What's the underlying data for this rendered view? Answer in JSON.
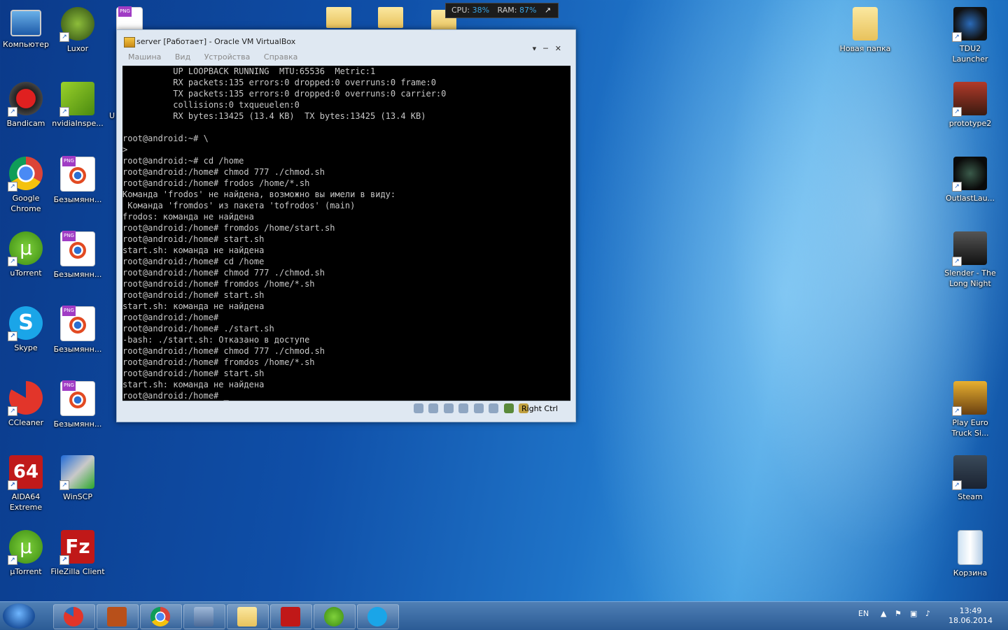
{
  "desktop": {
    "icons_left": [
      {
        "label": "Компьютер",
        "icon": "computer-icon"
      },
      {
        "label": "Luxor",
        "icon": "luxor-icon"
      },
      {
        "label": "Bandicam",
        "icon": "bandicam-icon"
      },
      {
        "label": "nvidiaInspe...",
        "icon": "nvidia-icon"
      },
      {
        "label": "Google Chrome",
        "icon": "chrome-icon"
      },
      {
        "label": "Безымянн...",
        "icon": "png-file-icon"
      },
      {
        "label": "uTorrent",
        "icon": "utorrent-icon"
      },
      {
        "label": "Безымянн...",
        "icon": "png-file-icon"
      },
      {
        "label": "Skype",
        "icon": "skype-icon"
      },
      {
        "label": "Безымянн...",
        "icon": "png-file-icon"
      },
      {
        "label": "CCleaner",
        "icon": "ccleaner-icon"
      },
      {
        "label": "Безымянн...",
        "icon": "png-file-icon"
      },
      {
        "label": "AIDA64 Extreme",
        "icon": "aida64-icon"
      },
      {
        "label": "WinSCP",
        "icon": "winscp-icon"
      },
      {
        "label": "µTorrent",
        "icon": "utorrent-icon"
      },
      {
        "label": "FileZilla Client",
        "icon": "filezilla-icon"
      }
    ],
    "partial_label": "U",
    "icons_right": [
      {
        "label": "Новая папка",
        "icon": "folder-icon"
      },
      {
        "label": "TDU2 Launcher",
        "icon": "tdu2-icon"
      },
      {
        "label": "prototype2",
        "icon": "prototype2-icon"
      },
      {
        "label": "OutlastLau...",
        "icon": "outlast-icon"
      },
      {
        "label": "Slender - The Long Night",
        "icon": "slender-icon"
      },
      {
        "label": "Play Euro Truck Si...",
        "icon": "eurotruck-icon"
      },
      {
        "label": "Steam",
        "icon": "steam-icon"
      },
      {
        "label": "Корзина",
        "icon": "recycle-bin-icon"
      }
    ]
  },
  "perf": {
    "cpu_label": "CPU:",
    "cpu": "38%",
    "ram_label": "RAM:",
    "ram": "87%",
    "arrow": "↗"
  },
  "vbox": {
    "title": "server [Работает] - Oracle VM VirtualBox",
    "buttons": [
      "▾",
      "─",
      "✕"
    ],
    "menu": [
      "Машина",
      "Вид",
      "Устройства",
      "Справка"
    ],
    "host_key": "Right Ctrl",
    "terminal_lines": [
      "          UP LOOPBACK RUNNING  MTU:65536  Metric:1",
      "          RX packets:135 errors:0 dropped:0 overruns:0 frame:0",
      "          TX packets:135 errors:0 dropped:0 overruns:0 carrier:0",
      "          collisions:0 txqueuelen:0",
      "          RX bytes:13425 (13.4 KB)  TX bytes:13425 (13.4 KB)",
      "",
      "root@android:~# \\",
      ">",
      "root@android:~# cd /home",
      "root@android:/home# chmod 777 ./chmod.sh",
      "root@android:/home# frodos /home/*.sh",
      "Команда 'frodos' не найдена, возможно вы имели в виду:",
      " Команда 'fromdos' из пакета 'tofrodos' (main)",
      "frodos: команда не найдена",
      "root@android:/home# fromdos /home/start.sh",
      "root@android:/home# start.sh",
      "start.sh: команда не найдена",
      "root@android:/home# cd /home",
      "root@android:/home# chmod 777 ./chmod.sh",
      "root@android:/home# fromdos /home/*.sh",
      "root@android:/home# start.sh",
      "start.sh: команда не найдена",
      "root@android:/home#",
      "root@android:/home# ./start.sh",
      "-bash: ./start.sh: Отказано в доступе",
      "root@android:/home# chmod 777 ./chmod.sh",
      "root@android:/home# fromdos /home/*.sh",
      "root@android:/home# start.sh",
      "start.sh: команда не найдена",
      "root@android:/home# _"
    ]
  },
  "taskbar": {
    "apps": [
      "ccleaner-icon",
      "game-icon",
      "chrome-icon",
      "virtualbox-icon",
      "explorer-icon",
      "filezilla-icon",
      "utorrent-icon",
      "skype-icon"
    ],
    "lang": "EN",
    "time": "13:49",
    "date": "18.06.2014"
  },
  "colors": {
    "accent": "#39a6e8",
    "terminal_bg": "#000000",
    "terminal_fg": "#c8c8c8"
  }
}
